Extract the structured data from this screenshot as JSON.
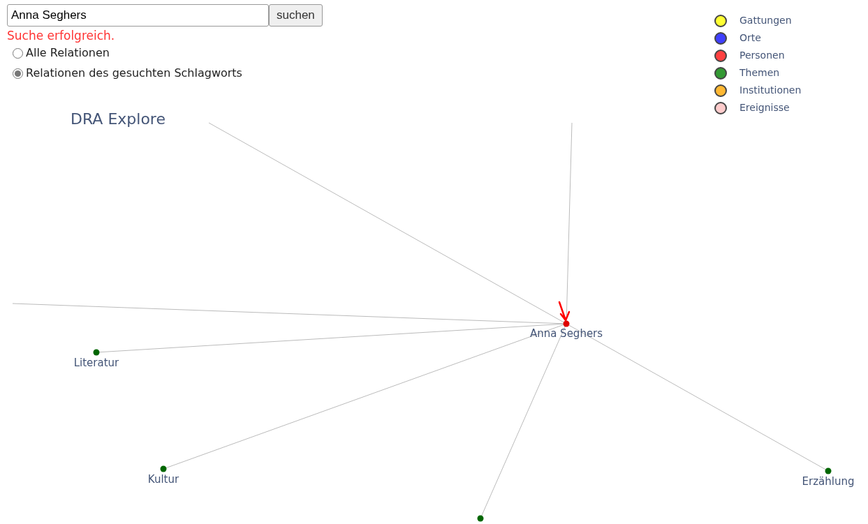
{
  "search": {
    "value": "Anna Seghers",
    "button": "suchen"
  },
  "status": "Suche erfolgreich.",
  "radios": [
    {
      "label": "Alle Relationen",
      "selected": false
    },
    {
      "label": "Relationen des gesuchten Schlagworts",
      "selected": true
    }
  ],
  "title": "DRA Explore",
  "legend": [
    {
      "label": "Gattungen",
      "color": "#ffff33"
    },
    {
      "label": "Orte",
      "color": "#4040ff"
    },
    {
      "label": "Personen",
      "color": "#ff4040"
    },
    {
      "label": "Themen",
      "color": "#339933"
    },
    {
      "label": "Institutionen",
      "color": "#ffb833"
    },
    {
      "label": "Ereignisse",
      "color": "#ffcccc"
    }
  ],
  "graph": {
    "center": {
      "label": "Anna Seghers",
      "color": "#dd0000",
      "highlighted": true
    },
    "nodes": [
      {
        "label": "Literatur",
        "color": "#006600"
      },
      {
        "label": "Kultur",
        "color": "#006600"
      },
      {
        "color": "#006600"
      },
      {
        "label": "Erzählung",
        "color": "#006600"
      }
    ]
  }
}
